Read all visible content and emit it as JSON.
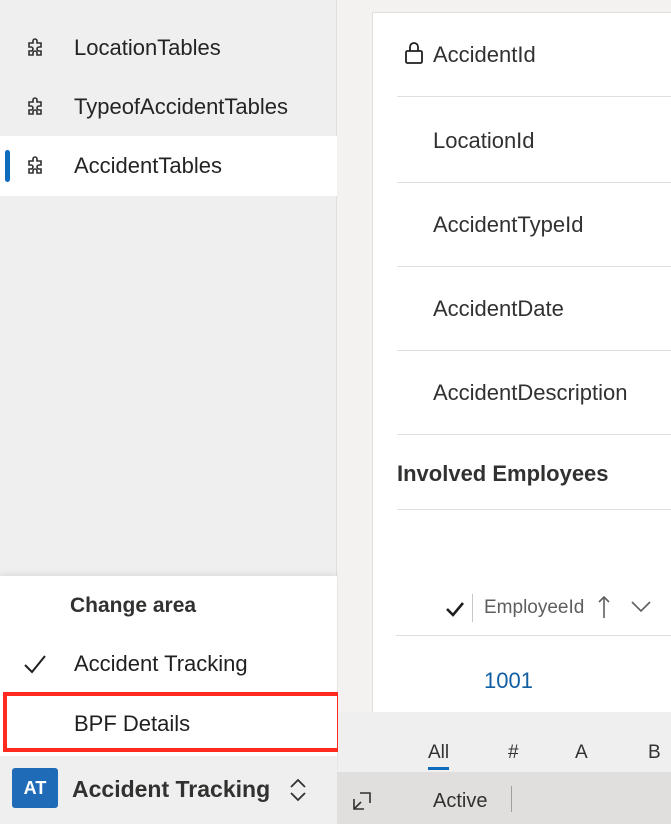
{
  "sidebar": {
    "items": [
      {
        "label": "LocationTables",
        "icon": "puzzle-icon"
      },
      {
        "label": "TypeofAccidentTables",
        "icon": "puzzle-icon"
      },
      {
        "label": "AccidentTables",
        "icon": "puzzle-icon",
        "selected": true
      }
    ]
  },
  "area_popup": {
    "title": "Change area",
    "items": [
      {
        "label": "Accident Tracking",
        "checked": true
      },
      {
        "label": "BPF Details",
        "checked": false
      }
    ]
  },
  "area_switcher": {
    "avatar": "AT",
    "name": "Accident Tracking"
  },
  "form": {
    "fields": [
      {
        "label": "AccidentId",
        "locked": true
      },
      {
        "label": "LocationId"
      },
      {
        "label": "AccidentTypeId"
      },
      {
        "label": "AccidentDate"
      },
      {
        "label": "AccidentDescription"
      }
    ],
    "section_title": "Involved Employees",
    "grid": {
      "column": "EmployeeId",
      "rows": [
        "1001"
      ]
    },
    "alpha_filter": [
      "All",
      "#",
      "A",
      "B"
    ]
  },
  "status_bar": {
    "status": "Active"
  },
  "colors": {
    "accent": "#0f6cbd",
    "avatar_bg": "#1f6bb8",
    "highlight": "#ff2a1f",
    "link": "#115ea3"
  }
}
